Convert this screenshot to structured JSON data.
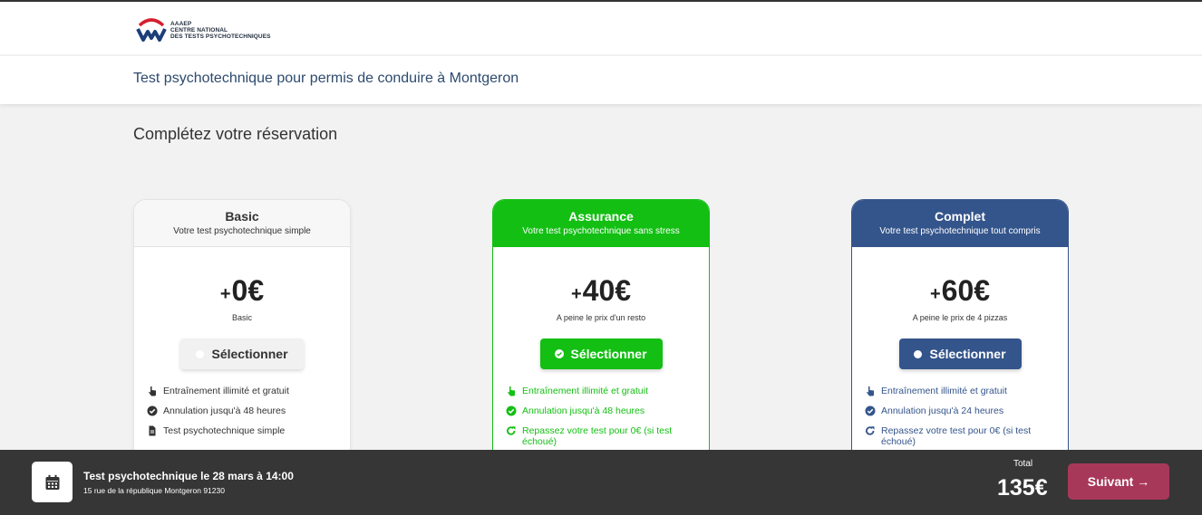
{
  "header": {
    "logo": {
      "line1": "AAAEP",
      "line2": "CENTRE NATIONAL",
      "line3": "DES TESTS PSYCHOTECHNIQUES"
    },
    "page_title": "Test psychotechnique pour permis de conduire à Montgeron"
  },
  "main": {
    "section_title": "Complétez votre réservation",
    "plans": [
      {
        "name": "Basic",
        "subtitle": "Votre test psychotechnique simple",
        "plus": "+",
        "price": "0€",
        "note": "Basic",
        "select_label": "Sélectionner",
        "selected": false,
        "features": [
          {
            "icon": "pointer-hand-icon",
            "text": "Entraînement illimité et gratuit"
          },
          {
            "icon": "check-circle-icon",
            "text": "Annulation jusqu'à 48 heures"
          },
          {
            "icon": "document-icon",
            "text": "Test psychotechnique simple"
          }
        ]
      },
      {
        "name": "Assurance",
        "subtitle": "Votre test psychotechnique sans stress",
        "plus": "+",
        "price": "40€",
        "note": "A peine le prix d'un resto",
        "select_label": "Sélectionner",
        "selected": true,
        "features": [
          {
            "icon": "pointer-hand-icon",
            "text": "Entraînement illimité et gratuit"
          },
          {
            "icon": "check-circle-icon",
            "text": "Annulation jusqu'à 48 heures"
          },
          {
            "icon": "redo-icon",
            "text": "Repassez votre test pour 0€ (si test échoué)"
          }
        ]
      },
      {
        "name": "Complet",
        "subtitle": "Votre test psychotechnique tout compris",
        "plus": "+",
        "price": "60€",
        "note": "A peine le prix de 4 pizzas",
        "select_label": "Sélectionner",
        "selected": false,
        "features": [
          {
            "icon": "pointer-hand-icon",
            "text": "Entraînement illimité et gratuit"
          },
          {
            "icon": "check-circle-icon",
            "text": "Annulation jusqu'à 24 heures"
          },
          {
            "icon": "redo-icon",
            "text": "Repassez votre test pour 0€ (si test échoué)"
          }
        ]
      }
    ]
  },
  "footer": {
    "icon": "calendar-icon",
    "booking_title": "Test psychotechnique le 28 mars à 14:00",
    "booking_address": "15 rue de la république Montgeron 91230",
    "total_label": "Total",
    "total_value": "135€",
    "next_label": "Suivant →"
  },
  "colors": {
    "assurance": "#13bf13",
    "complet": "#34558b",
    "next_button": "#a8385a",
    "footer_bg": "#363636",
    "title": "#2d4a6e"
  }
}
